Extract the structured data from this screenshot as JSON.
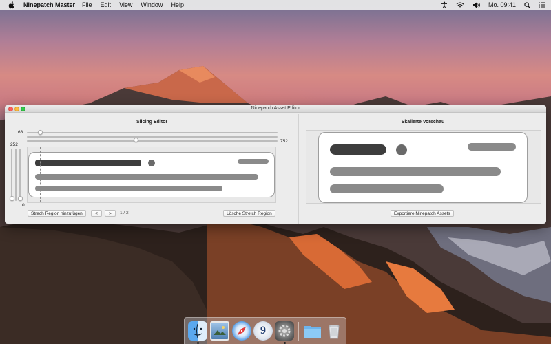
{
  "menubar": {
    "app_name": "Ninepatch Master",
    "menus": [
      "File",
      "Edit",
      "View",
      "Window",
      "Help"
    ],
    "clock": "Mo. 09:41"
  },
  "window": {
    "title": "Ninepatch Asset Editor"
  },
  "slicing_editor": {
    "title": "Slicing Editor",
    "top_slider_value": "68",
    "right_slider_value": "752",
    "left_slider_value": "252",
    "bottom_slider_value": "0",
    "add_region_label": "Strech Region hinzufügen",
    "prev_label": "<",
    "next_label": ">",
    "pager": "1 / 2",
    "delete_region_label": "Lösche Stretch Region"
  },
  "preview": {
    "title": "Skalierte Vorschau",
    "export_label": "Exportiere Ninepatch Assets"
  },
  "dock": {
    "icons": [
      "finder-icon",
      "preview-icon",
      "safari-icon",
      "calendar-icon",
      "system-preferences-icon",
      "folder-icon",
      "trash-icon"
    ],
    "calendar_day": "9"
  },
  "colors": {
    "dark_bar": "#3d3d3d",
    "mid_bar": "#8a8a8a",
    "window_bg": "#ececec"
  }
}
